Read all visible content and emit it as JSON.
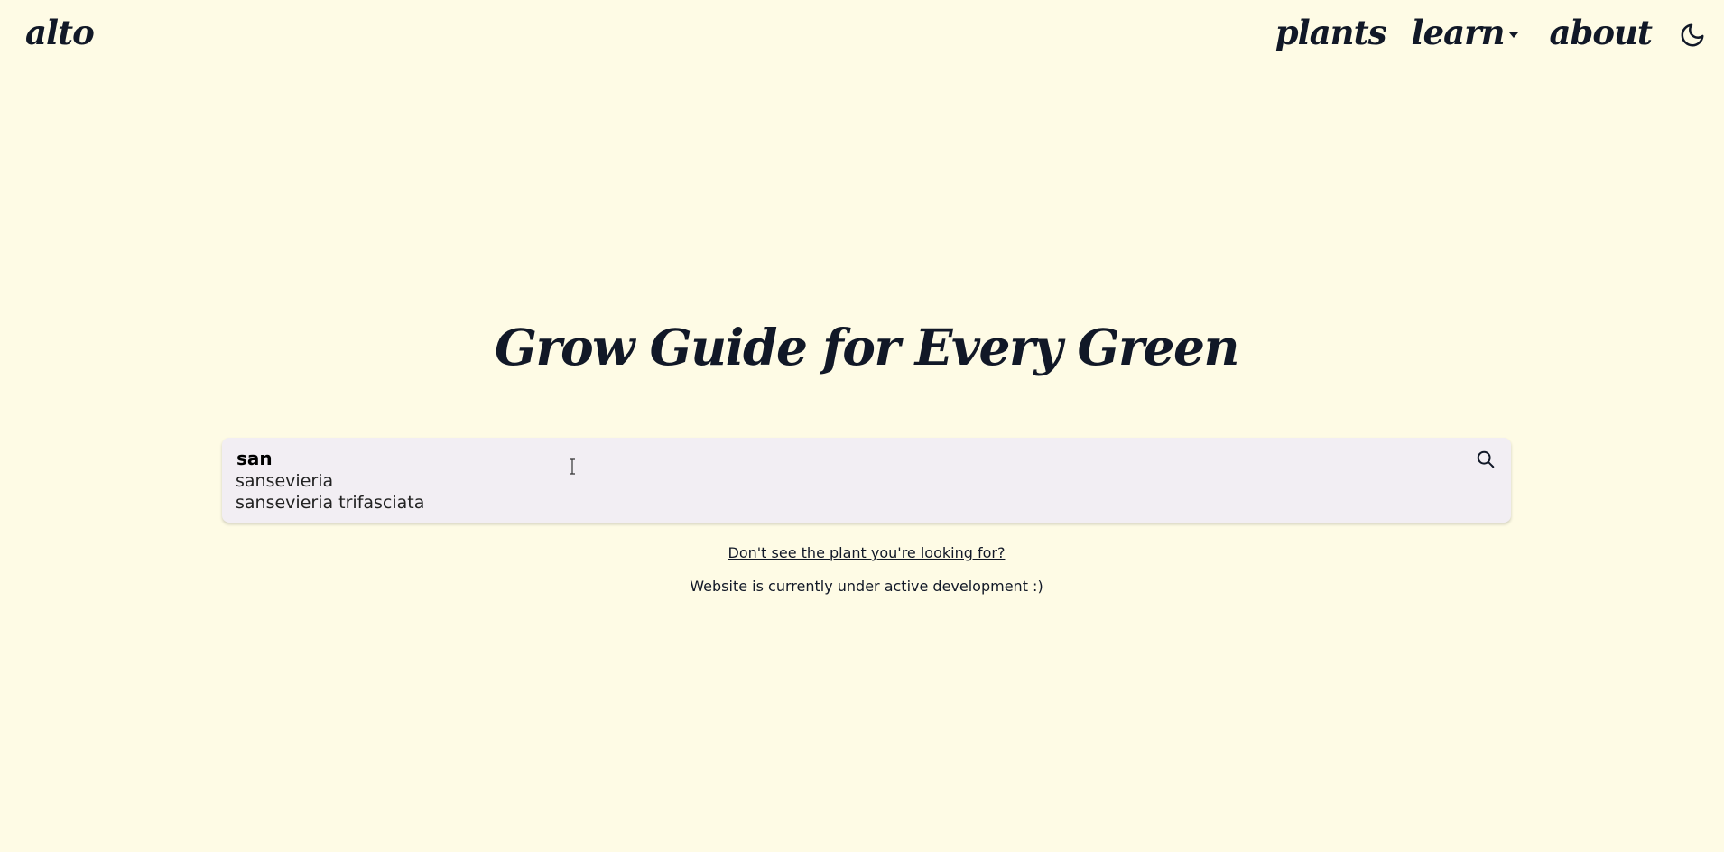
{
  "header": {
    "logo": "alto",
    "nav": {
      "plants": "plants",
      "learn": "learn",
      "about": "about"
    },
    "theme_toggle_icon": "moon-icon"
  },
  "hero": {
    "title": "Grow Guide for Every Green"
  },
  "search": {
    "value": "san",
    "icon": "search-icon",
    "suggestions": [
      "sansevieria",
      "sansevieria trifasciata"
    ]
  },
  "footer": {
    "missing_link": "Don't see the plant you're looking for?",
    "dev_note": "Website is currently under active development :)"
  },
  "colors": {
    "background": "#fefbe5",
    "text": "#111827",
    "search_bg": "#f2eef3"
  }
}
